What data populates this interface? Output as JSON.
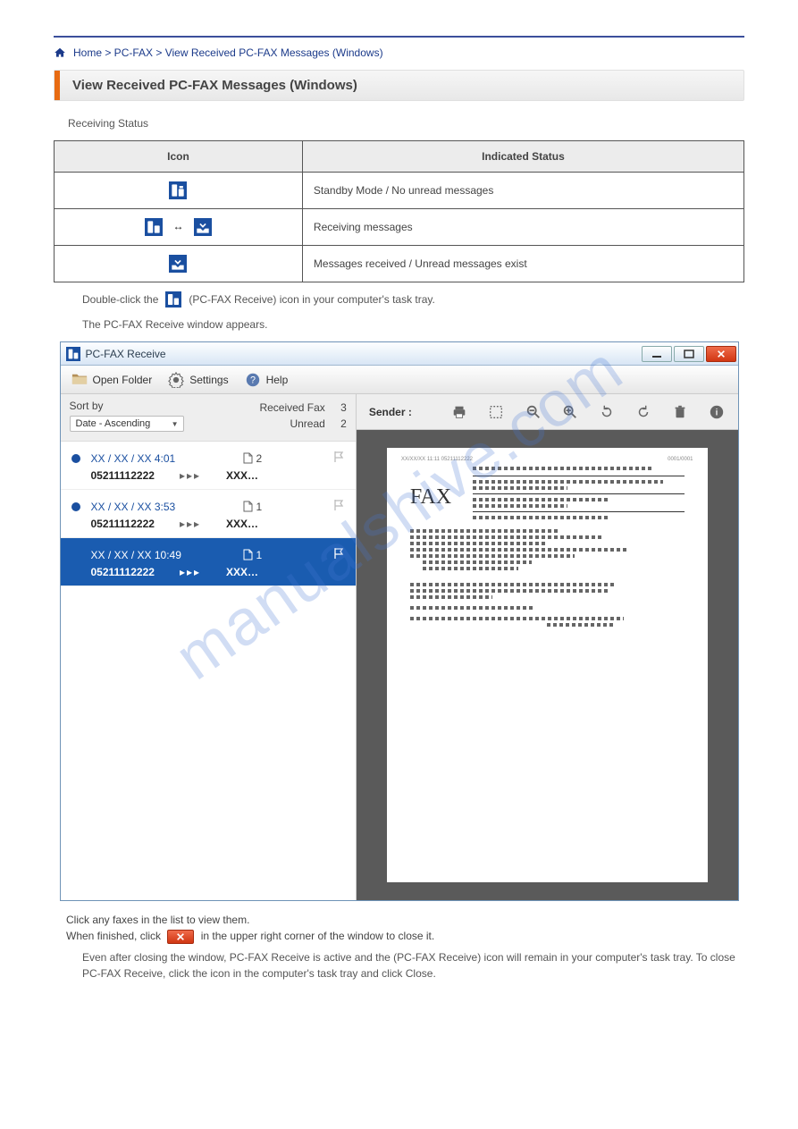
{
  "breadcrumb": {
    "home_text": "Home > PC-FAX > View Received PC-FAX Messages (Windows)"
  },
  "subsection": {
    "title": "View Received PC-FAX Messages (Windows)"
  },
  "intro_para": "Receiving Status",
  "icon_table": {
    "header_icon": "Icon",
    "header_status": "Indicated Status",
    "rows": [
      {
        "status": "Standby Mode / No unread messages"
      },
      {
        "status": "Receiving messages"
      },
      {
        "status": "Messages received / Unread messages exist"
      }
    ]
  },
  "step_text_prefix": "Double-click the",
  "step_text_mid": "(PC-FAX Receive) icon in your computer's task tray.",
  "step_text_after": "The PC-FAX Receive window appears.",
  "app": {
    "title": "PC-FAX Receive",
    "menu": {
      "open_folder": "Open Folder",
      "settings": "Settings",
      "help": "Help"
    },
    "sort": {
      "label": "Sort by",
      "selected": "Date - Ascending"
    },
    "counts": {
      "received_label": "Received Fax",
      "received_value": "3",
      "unread_label": "Unread",
      "unread_value": "2"
    },
    "items": [
      {
        "datetime": "XX / XX / XX  4:01",
        "pages": "2",
        "number": "05211112222",
        "who": "XXX…",
        "unread": true,
        "selected": false
      },
      {
        "datetime": "XX / XX / XX  3:53",
        "pages": "1",
        "number": "05211112222",
        "who": "XXX…",
        "unread": true,
        "selected": false
      },
      {
        "datetime": "XX / XX / XX 10:49",
        "pages": "1",
        "number": "05211112222",
        "who": "XXX…",
        "unread": false,
        "selected": true
      }
    ],
    "preview": {
      "sender_label": "Sender :",
      "header_left": "XX/XX/XX   11:11    05211112222",
      "header_right": "0001/0001",
      "fax_word": "FAX"
    }
  },
  "post_text_1": "Click any faxes in the list to view them.",
  "post_text_2": "When finished, click",
  "post_text_3": "in the upper right corner of the window to close it.",
  "post_text_4": "Even after closing the window, PC-FAX Receive is active and the (PC-FAX Receive) icon will remain in your computer's task tray. To close PC-FAX Receive, click the icon in the computer's task tray and click Close.",
  "watermark": "manualshive.com"
}
